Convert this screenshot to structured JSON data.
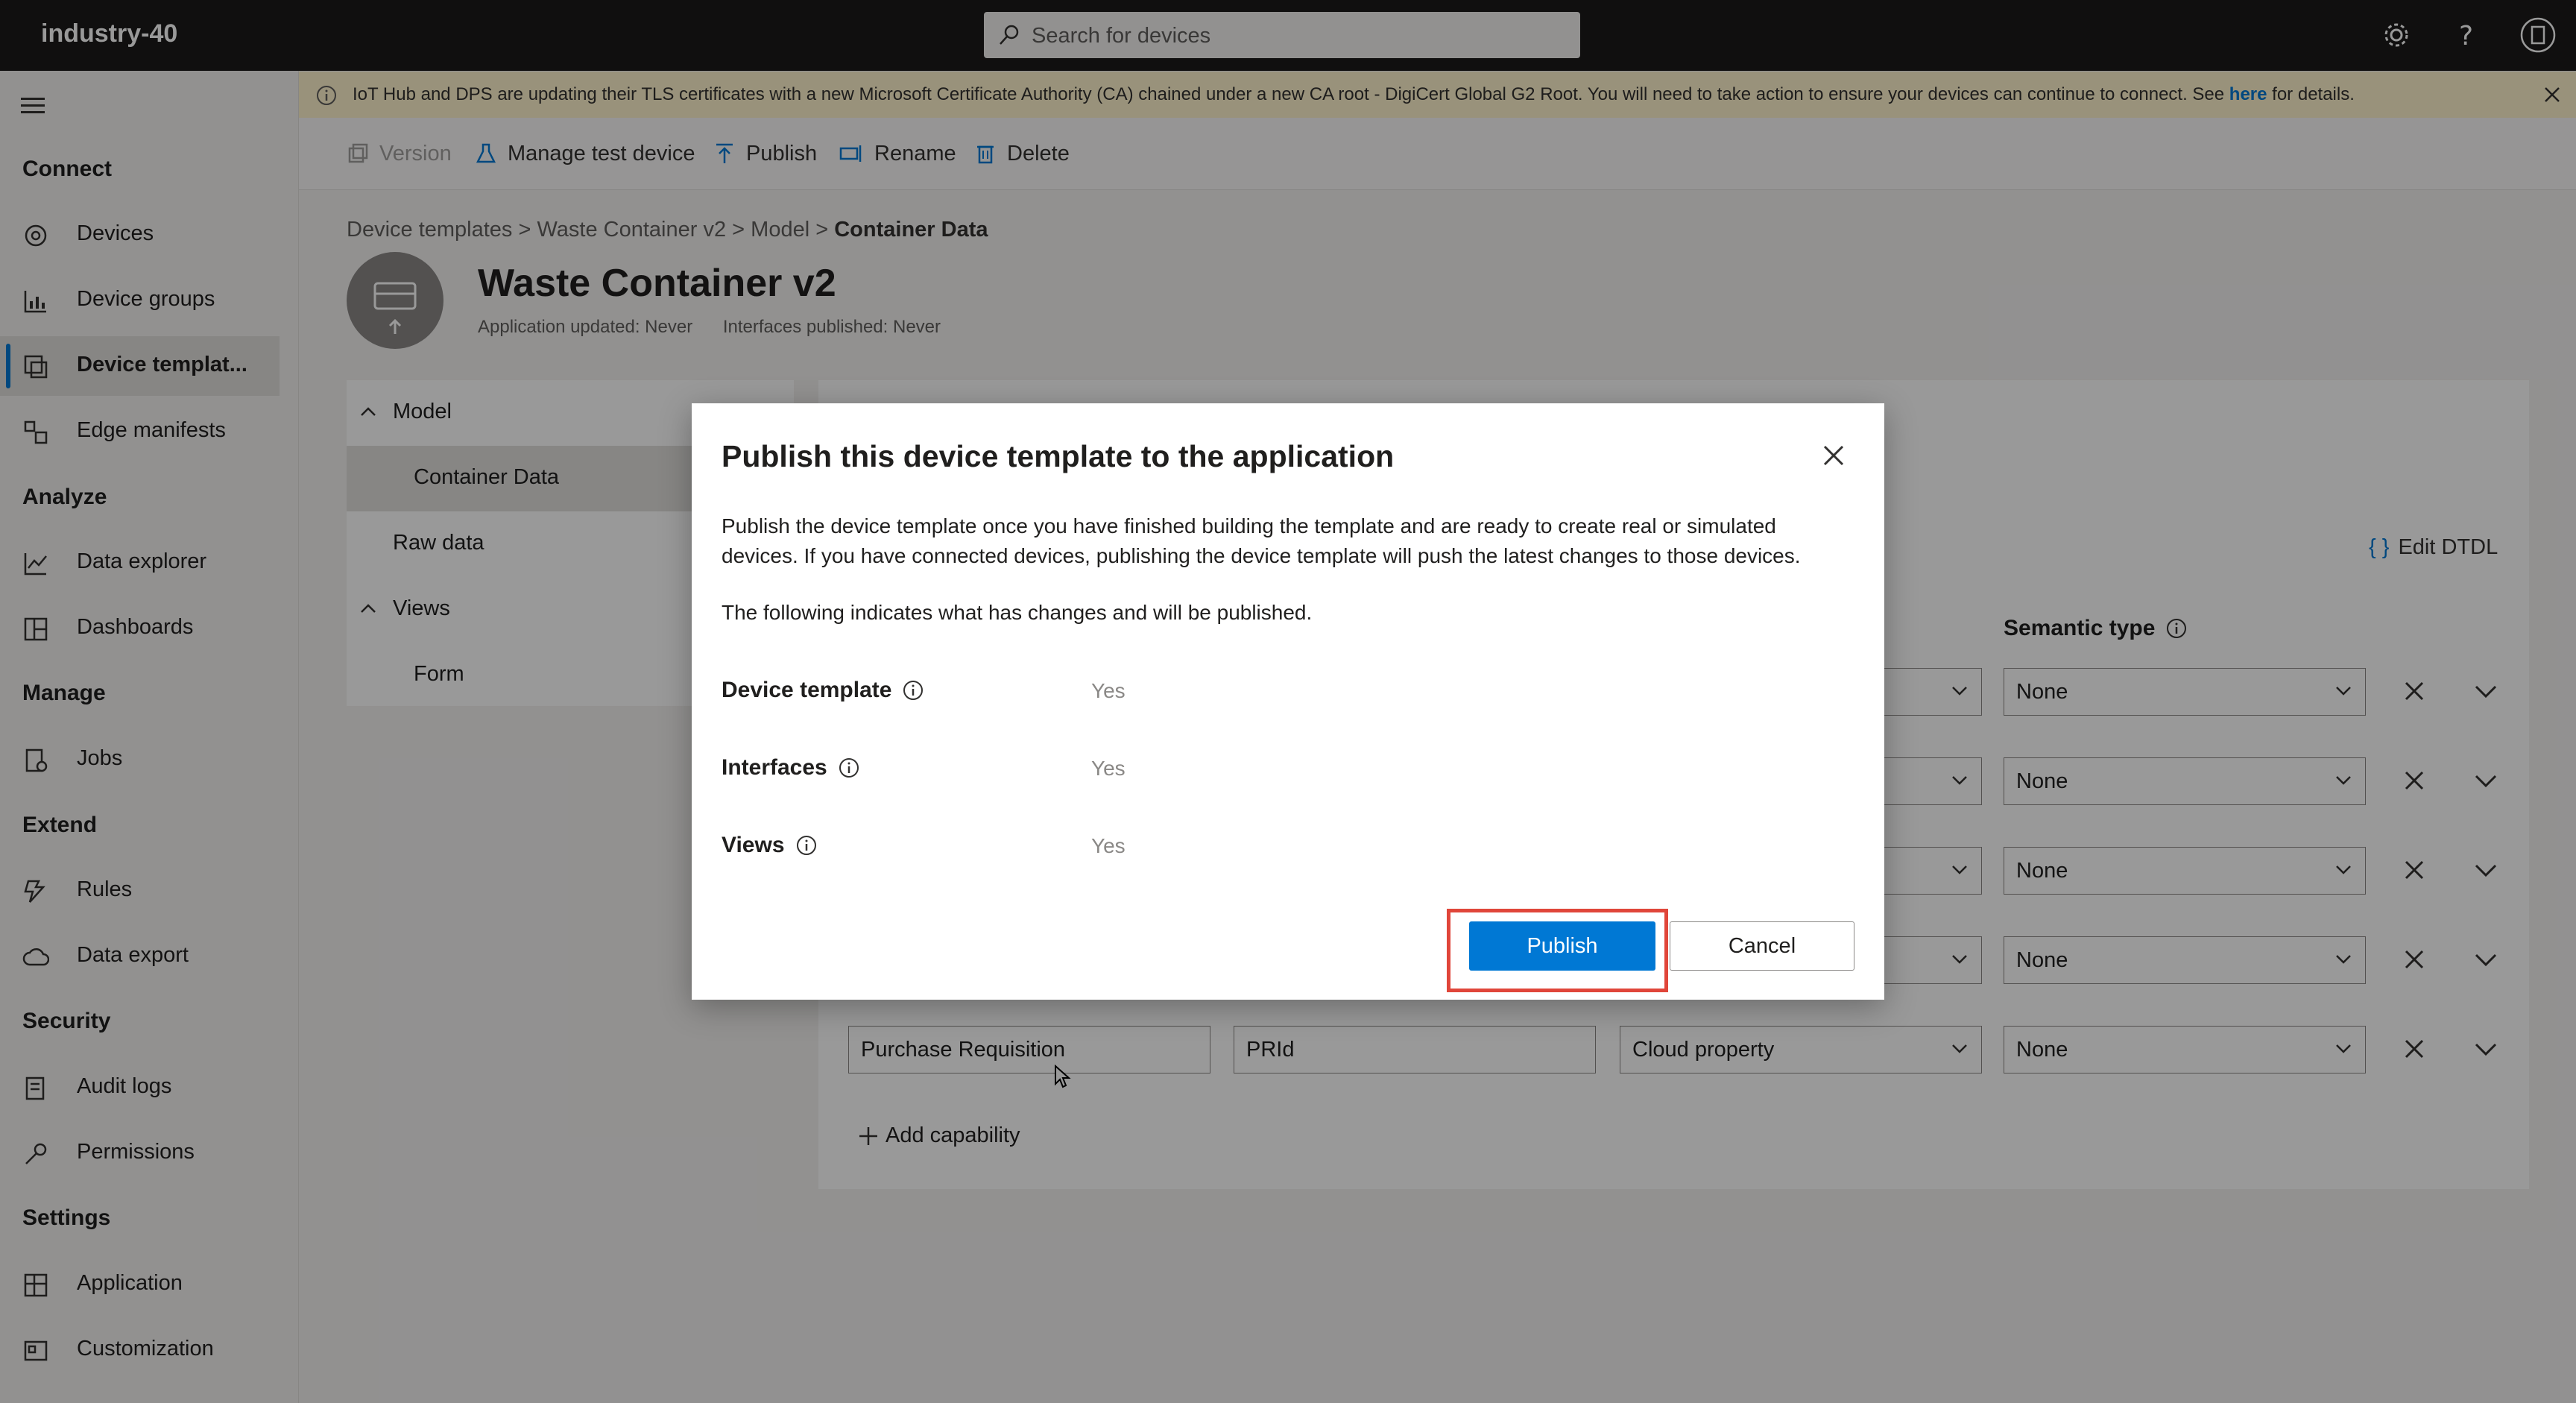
{
  "app": {
    "title": "industry-40"
  },
  "search": {
    "placeholder": "Search for devices"
  },
  "sidebar": {
    "sections": [
      {
        "label": "Connect"
      },
      {
        "label": "Analyze"
      },
      {
        "label": "Manage"
      },
      {
        "label": "Extend"
      },
      {
        "label": "Security"
      },
      {
        "label": "Settings"
      }
    ],
    "items": [
      {
        "label": "Devices",
        "icon": "devices-icon"
      },
      {
        "label": "Device groups",
        "icon": "device-groups-icon"
      },
      {
        "label": "Device templat...",
        "icon": "device-templates-icon",
        "active": true
      },
      {
        "label": "Edge manifests",
        "icon": "edge-manifests-icon"
      },
      {
        "label": "Data explorer",
        "icon": "data-explorer-icon"
      },
      {
        "label": "Dashboards",
        "icon": "dashboards-icon"
      },
      {
        "label": "Jobs",
        "icon": "jobs-icon"
      },
      {
        "label": "Rules",
        "icon": "rules-icon"
      },
      {
        "label": "Data export",
        "icon": "data-export-icon"
      },
      {
        "label": "Audit logs",
        "icon": "audit-logs-icon"
      },
      {
        "label": "Permissions",
        "icon": "permissions-icon"
      },
      {
        "label": "Application",
        "icon": "application-icon"
      },
      {
        "label": "Customization",
        "icon": "customization-icon"
      }
    ]
  },
  "banner": {
    "text": "IoT Hub and DPS are updating their TLS certificates with a new Microsoft Certificate Authority (CA) chained under a new CA root - DigiCert Global G2 Root. You will need to take action to ensure your devices can continue to connect. See ",
    "link": "here",
    "suffix": " for details."
  },
  "toolbar": {
    "version": "Version",
    "manage_test_device": "Manage test device",
    "publish": "Publish",
    "rename": "Rename",
    "delete": "Delete"
  },
  "breadcrumb": {
    "items": [
      "Device templates",
      "Waste Container v2",
      "Model"
    ],
    "current": "Container Data"
  },
  "template": {
    "title": "Waste Container v2",
    "app_updated": "Application updated: Never",
    "interfaces_published": "Interfaces published: Never"
  },
  "tree": {
    "model": "Model",
    "container_data": "Container Data",
    "raw_data": "Raw data",
    "views": "Views",
    "form": "Form"
  },
  "editor": {
    "edit_dtdl": "Edit DTDL",
    "semantic_type_header": "Semantic type",
    "semantic_none": "None",
    "last_row": {
      "display_name": "Purchase Requisition",
      "name": "PRId",
      "capability_type": "Cloud property",
      "semantic": "None"
    },
    "add_capability": "Add capability"
  },
  "dialog": {
    "title": "Publish this device template to the application",
    "description": "Publish the device template once you have finished building the template and are ready to create real or simulated devices. If you have connected devices, publishing the device template will push the latest changes to those devices.",
    "subtitle": "The following indicates what has changes and will be published.",
    "rows": [
      {
        "label": "Device template",
        "value": "Yes"
      },
      {
        "label": "Interfaces",
        "value": "Yes"
      },
      {
        "label": "Views",
        "value": "Yes"
      }
    ],
    "publish": "Publish",
    "cancel": "Cancel"
  },
  "colors": {
    "accent": "#0078d4",
    "highlight": "#e0463a",
    "banner_bg": "#fff4ce",
    "topbar_bg": "#1b1a19"
  }
}
